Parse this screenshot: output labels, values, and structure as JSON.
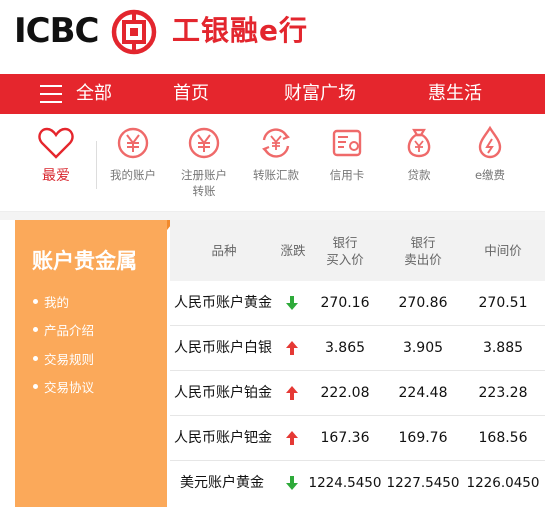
{
  "brand": {
    "logo_text": "ICBC",
    "chinese_name": "工银融e行",
    "seal_icon": "icbc-seal-icon"
  },
  "nav": {
    "menu_icon": "hamburger-icon",
    "items": [
      {
        "label": "全部"
      },
      {
        "label": "首页"
      },
      {
        "label": "财富广场"
      },
      {
        "label": "惠生活"
      }
    ]
  },
  "quick_links": [
    {
      "label": "最爱",
      "icon": "heart-icon"
    },
    {
      "label": "我的账户",
      "icon": "yen-coin-icon"
    },
    {
      "label": "注册账户转账",
      "icon": "yen-coin-icon"
    },
    {
      "label": "转账汇款",
      "icon": "transfer-icon"
    },
    {
      "label": "信用卡",
      "icon": "credit-card-icon"
    },
    {
      "label": "贷款",
      "icon": "money-bag-icon"
    },
    {
      "label": "e缴费",
      "icon": "drop-icon"
    }
  ],
  "sidebar": {
    "title": "账户贵金属",
    "links": [
      {
        "label": "我的"
      },
      {
        "label": "产品介绍"
      },
      {
        "label": "交易规则"
      },
      {
        "label": "交易协议"
      }
    ]
  },
  "table": {
    "headers": {
      "product": "品种",
      "change": "涨跌",
      "bank_buy_line1": "银行",
      "bank_buy_line2": "买入价",
      "bank_sell_line1": "银行",
      "bank_sell_line2": "卖出价",
      "mid": "中间价"
    },
    "rows": [
      {
        "product": "人民币账户黄金",
        "trend": "down",
        "buy": "270.16",
        "sell": "270.86",
        "mid": "270.51"
      },
      {
        "product": "人民币账户白银",
        "trend": "up",
        "buy": "3.865",
        "sell": "3.905",
        "mid": "3.885"
      },
      {
        "product": "人民币账户铂金",
        "trend": "up",
        "buy": "222.08",
        "sell": "224.48",
        "mid": "223.28"
      },
      {
        "product": "人民币账户钯金",
        "trend": "up",
        "buy": "167.36",
        "sell": "169.76",
        "mid": "168.56"
      },
      {
        "product": "美元账户黄金",
        "trend": "down",
        "buy": "1224.5450",
        "sell": "1227.5450",
        "mid": "1226.0450"
      }
    ]
  },
  "colors": {
    "brand_red": "#e5262d",
    "accent_orange": "#fba95a",
    "icon_red": "#ef6a6a",
    "up_red": "#e53935",
    "down_green": "#2eaa3a"
  }
}
